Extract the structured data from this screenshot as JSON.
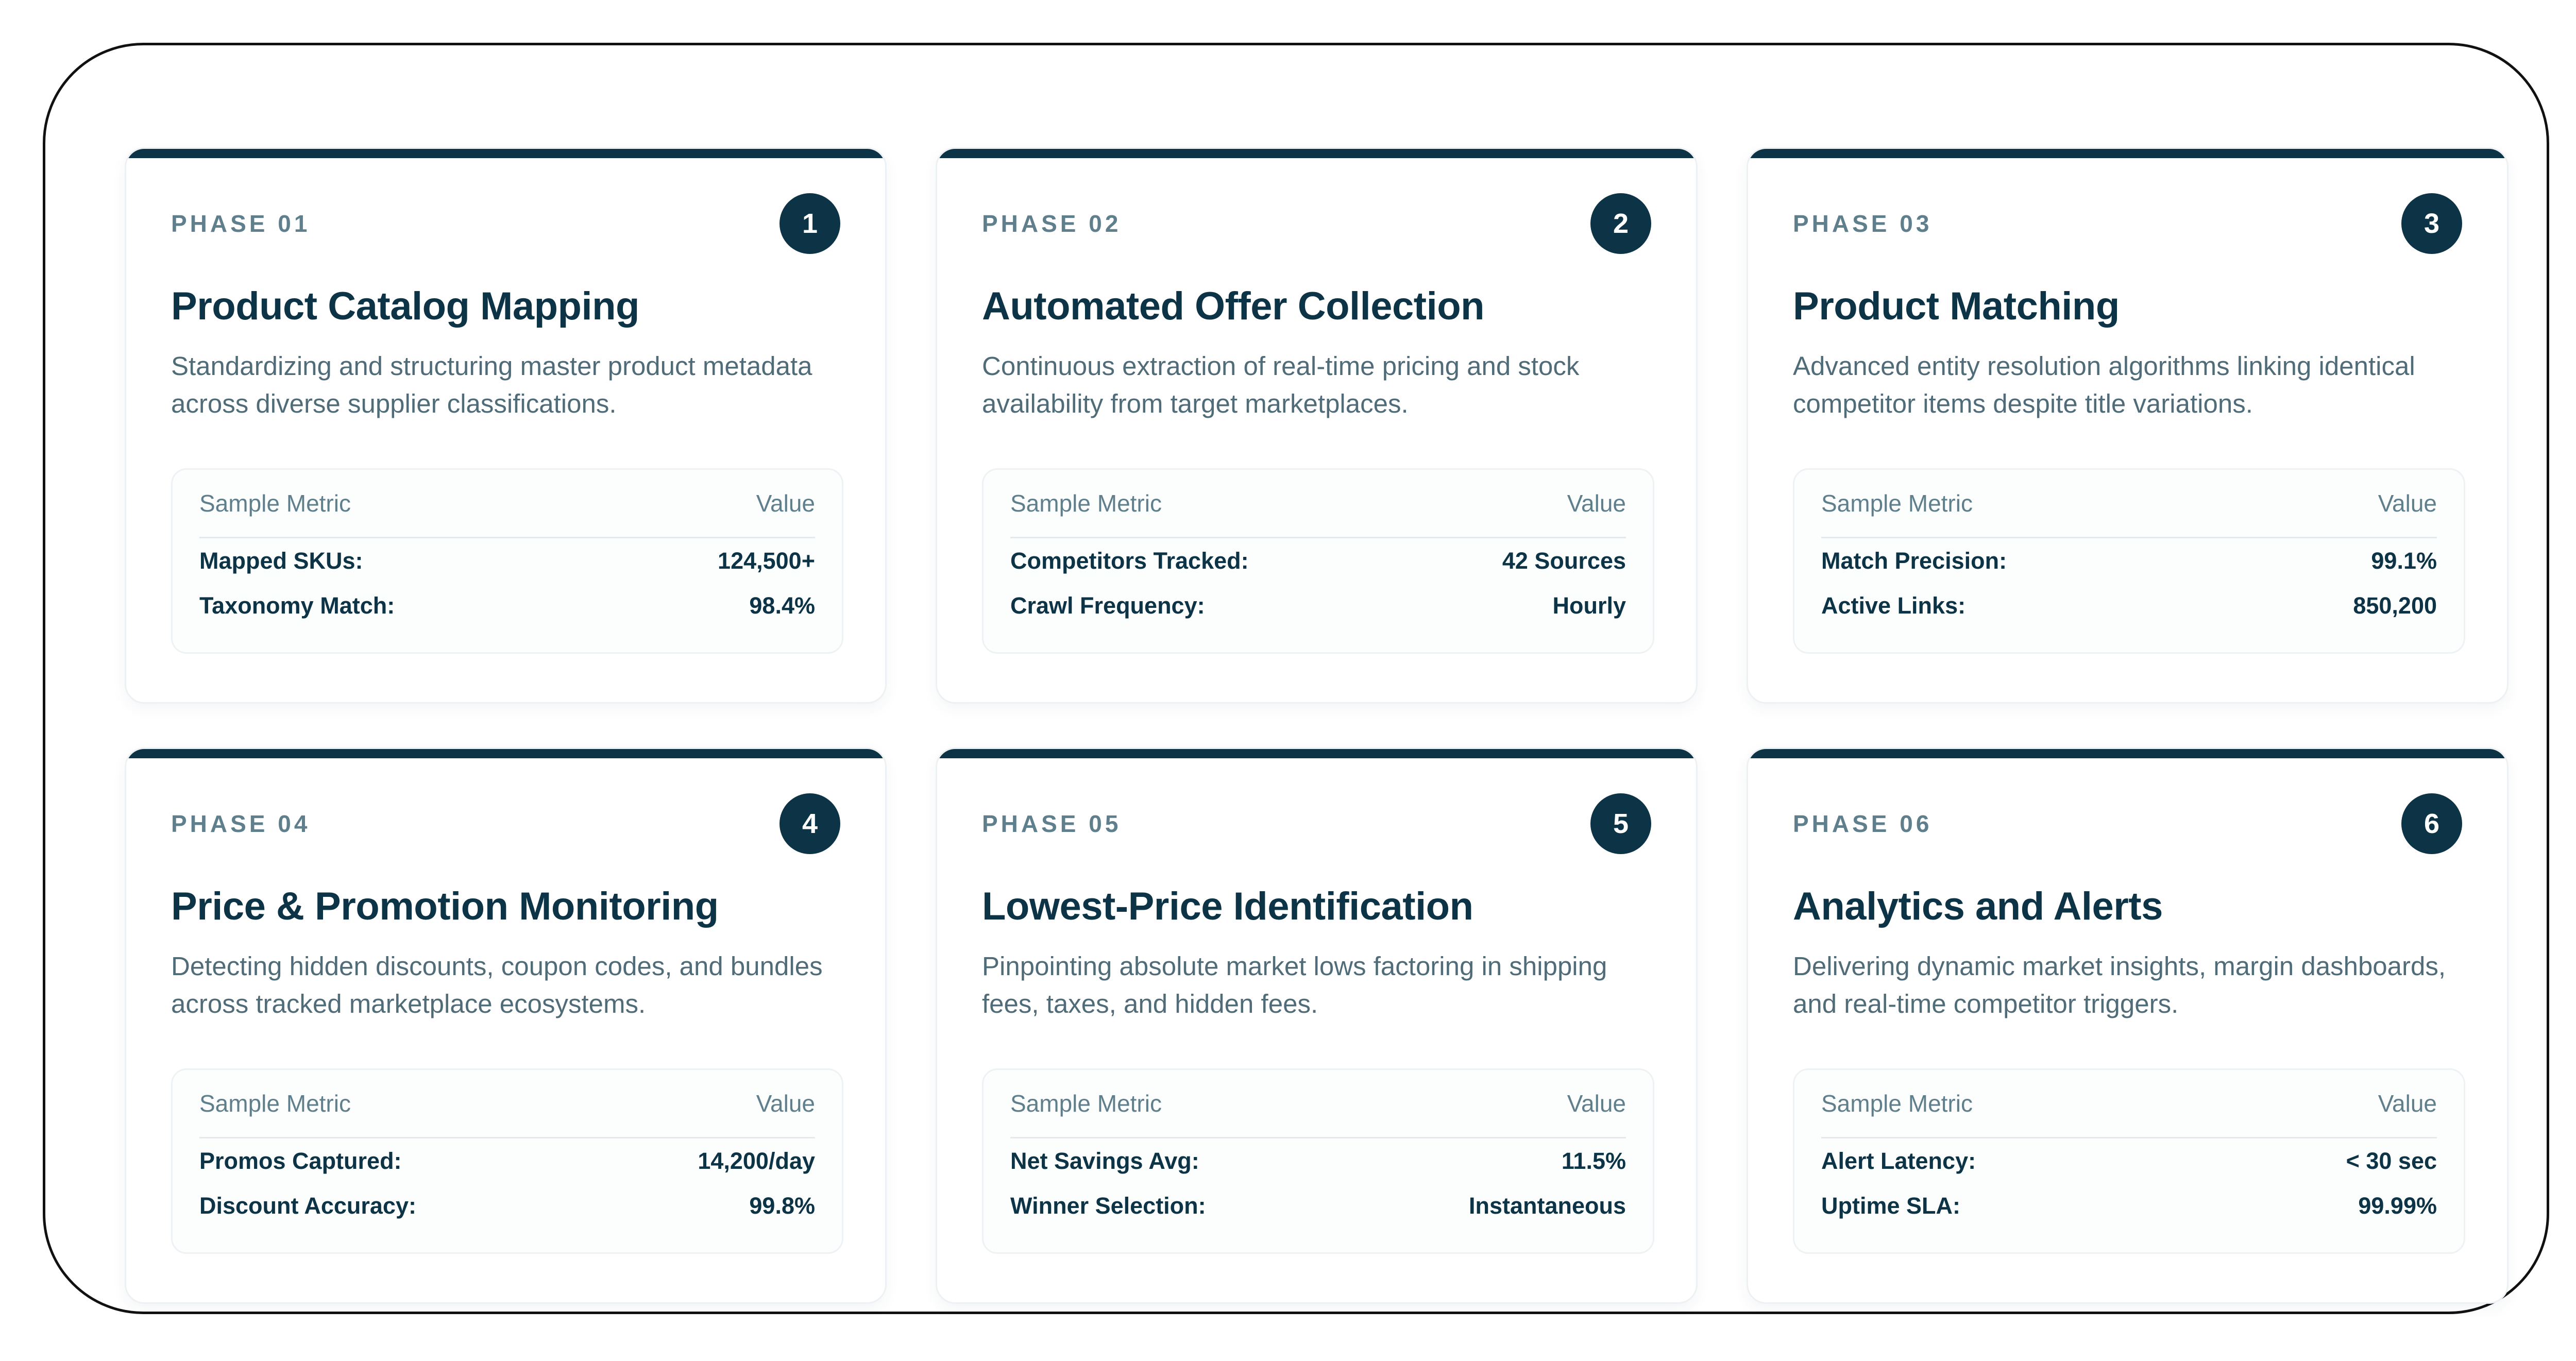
{
  "metric_header": {
    "label": "Sample Metric",
    "value": "Value"
  },
  "phases": [
    {
      "phase": "PHASE 01",
      "number": "1",
      "title": "Product Catalog Mapping",
      "description": "Standardizing and structuring master product metadata across diverse supplier classifications.",
      "metrics": [
        {
          "label": "Mapped SKUs:",
          "value": "124,500+"
        },
        {
          "label": "Taxonomy Match:",
          "value": "98.4%"
        }
      ]
    },
    {
      "phase": "PHASE 02",
      "number": "2",
      "title": "Automated Offer Collection",
      "description": "Continuous extraction of real-time pricing and stock availability from target marketplaces.",
      "metrics": [
        {
          "label": "Competitors Tracked:",
          "value": "42 Sources"
        },
        {
          "label": "Crawl Frequency:",
          "value": "Hourly"
        }
      ]
    },
    {
      "phase": "PHASE 03",
      "number": "3",
      "title": "Product Matching",
      "description": "Advanced entity resolution algorithms linking identical competitor items despite title variations.",
      "metrics": [
        {
          "label": "Match Precision:",
          "value": "99.1%"
        },
        {
          "label": "Active Links:",
          "value": "850,200"
        }
      ]
    },
    {
      "phase": "PHASE 04",
      "number": "4",
      "title": "Price & Promotion Monitoring",
      "description": "Detecting hidden discounts, coupon codes, and bundles across tracked marketplace ecosystems.",
      "metrics": [
        {
          "label": "Promos Captured:",
          "value": "14,200/day"
        },
        {
          "label": "Discount Accuracy:",
          "value": "99.8%"
        }
      ]
    },
    {
      "phase": "PHASE 05",
      "number": "5",
      "title": "Lowest-Price Identification",
      "description": "Pinpointing absolute market lows factoring in shipping fees, taxes, and hidden fees.",
      "metrics": [
        {
          "label": "Net Savings Avg:",
          "value": "11.5%"
        },
        {
          "label": "Winner Selection:",
          "value": "Instantaneous"
        }
      ]
    },
    {
      "phase": "PHASE 06",
      "number": "6",
      "title": "Analytics and Alerts",
      "description": "Delivering dynamic market insights, margin dashboards, and real-time competitor triggers.",
      "metrics": [
        {
          "label": "Alert Latency:",
          "value": "< 30 sec"
        },
        {
          "label": "Uptime SLA:",
          "value": "99.99%"
        }
      ]
    }
  ]
}
